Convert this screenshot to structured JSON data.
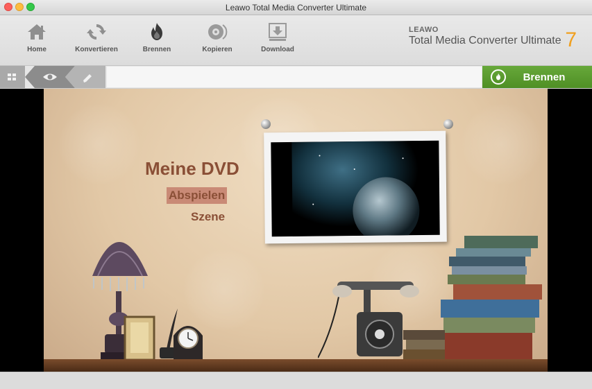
{
  "window": {
    "title": "Leawo Total Media Converter Ultimate"
  },
  "toolbar": {
    "items": [
      {
        "label": "Home",
        "icon": "home-icon"
      },
      {
        "label": "Konvertieren",
        "icon": "convert-icon"
      },
      {
        "label": "Brennen",
        "icon": "burn-icon"
      },
      {
        "label": "Kopieren",
        "icon": "copy-disc-icon"
      },
      {
        "label": "Download",
        "icon": "download-icon"
      }
    ]
  },
  "brand": {
    "logo": "LEAWO",
    "name": "Total Media Converter Ultimate",
    "version": "7"
  },
  "subbar": {
    "burn_label": "Brennen"
  },
  "menu": {
    "title": "Meine DVD",
    "play": "Abspielen",
    "scene": "Szene"
  },
  "colors": {
    "accent_green": "#5a9a2e",
    "menu_text": "#8a4f36",
    "menu_highlight": "#c98a76",
    "brand_orange": "#f0a020"
  }
}
